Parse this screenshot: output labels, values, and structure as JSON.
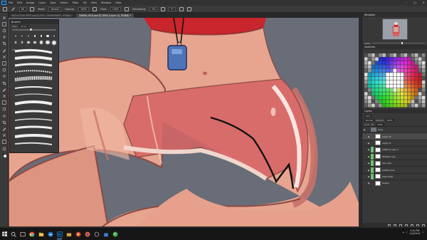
{
  "app": {
    "logo": "Ps",
    "menus": [
      "File",
      "Edit",
      "Image",
      "Layer",
      "Type",
      "Select",
      "Filter",
      "3D",
      "View",
      "Window",
      "Help"
    ],
    "window_controls": [
      "–",
      "□",
      "✕"
    ]
  },
  "options_bar": {
    "tool_icon": "brush-icon",
    "size_value": "60",
    "mode_label": "Mode:",
    "mode_value": "Normal",
    "opacity_label": "Opacity:",
    "opacity_value": "100%",
    "flow_label": "Flow:",
    "flow_value": "100%",
    "smoothing_label": "Smoothing:",
    "smoothing_value": "0%",
    "angle_value": "0°"
  },
  "tabs": [
    {
      "label": "SEDUCTION POSE.psd @ 50% (OVERBOARD, RGB/8) *",
      "active": false
    },
    {
      "label": "CHARA 2019.psd @ 200% (Layer 12, RGB/8) *",
      "active": true
    }
  ],
  "toolbar": {
    "tools": [
      "move-icon",
      "marquee-icon",
      "lasso-icon",
      "quick-select-icon",
      "crop-icon",
      "eyedropper-icon",
      "healing-icon",
      "brush-icon",
      "stamp-icon",
      "history-brush-icon",
      "eraser-icon",
      "gradient-icon",
      "blur-icon",
      "dodge-icon",
      "pen-icon",
      "type-icon",
      "path-select-icon",
      "shape-icon",
      "hand-icon",
      "zoom-icon",
      "more-icon",
      "colors-icon"
    ]
  },
  "brush_panel": {
    "title": "Brushes",
    "size_label": "Size:",
    "size_value": "60 px",
    "presets": [
      "1",
      "3",
      "5",
      "9",
      "13",
      "19",
      "5",
      "9",
      "13",
      "17",
      "21",
      "27",
      "35",
      "45"
    ],
    "folder_label": "▾ Brushes"
  },
  "navigator": {
    "title": "Navigator",
    "zoom_value": "200%"
  },
  "swatches": {
    "title": "Swatches"
  },
  "layers": {
    "title": "Layers",
    "kind_label": "Kind",
    "blend_mode": "Normal",
    "opacity_label": "Opacity:",
    "opacity_value": "100%",
    "lock_label": "Lock:",
    "fill_label": "Fill:",
    "fill_value": "100%",
    "items": [
      {
        "name": "body",
        "type": "group",
        "child": false,
        "selected": false,
        "mark": ""
      },
      {
        "name": "Layer 12",
        "type": "pixel",
        "child": true,
        "selected": true,
        "mark": ""
      },
      {
        "name": "Layer 11",
        "type": "pixel",
        "child": true,
        "selected": false,
        "mark": ""
      },
      {
        "name": "patterns copy 2",
        "type": "pixel",
        "child": true,
        "selected": false,
        "mark": "#6fbf73"
      },
      {
        "name": "Wristlet copy",
        "type": "pixel",
        "child": true,
        "selected": false,
        "mark": "#6fbf73"
      },
      {
        "name": "line copy",
        "type": "pixel",
        "child": true,
        "selected": false,
        "mark": "#6fbf73"
      },
      {
        "name": "bottom mex",
        "type": "pixel",
        "child": true,
        "selected": false,
        "mark": "#6fbf73"
      },
      {
        "name": "base temp",
        "type": "pixel",
        "child": true,
        "selected": false,
        "mark": "#6fbf73"
      },
      {
        "name": "bodies",
        "type": "pixel",
        "child": true,
        "selected": false,
        "mark": ""
      }
    ]
  },
  "taskbar": {
    "apps": [
      "search-icon",
      "task-view-icon",
      "chrome-icon",
      "explorer-icon",
      "edge-icon",
      "photoshop-icon",
      "folder-icon",
      "media-icon",
      "browser-icon",
      "settings-icon",
      "store-icon",
      "paint-icon"
    ],
    "active_app": "photoshop-icon",
    "time": "2:40 PM",
    "date": "2/4/2019"
  },
  "colors": {
    "canvas_bg": "#686d78",
    "skin": "#e7a48f",
    "skin_shadow": "#c7716a",
    "red_top": "#c8252c",
    "shorts": "#d66565",
    "whistle": "#4e74b8",
    "accent": "#31a8ff"
  }
}
